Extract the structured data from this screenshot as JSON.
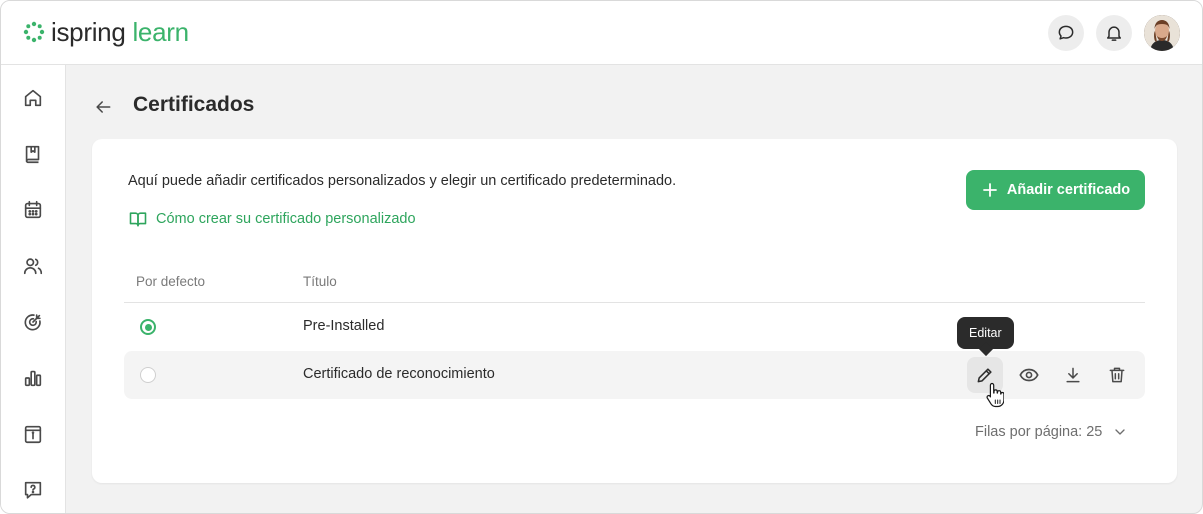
{
  "app": {
    "logo_word1": "ispring",
    "logo_word2": "learn",
    "brand_color": "#3bb36b"
  },
  "header": {
    "icons": [
      "chat-icon",
      "bell-icon",
      "user-avatar"
    ]
  },
  "sidebar": {
    "items": [
      {
        "icon": "home-icon"
      },
      {
        "icon": "book-icon"
      },
      {
        "icon": "calendar-icon"
      },
      {
        "icon": "users-icon"
      },
      {
        "icon": "target-icon"
      },
      {
        "icon": "bar-chart-icon"
      },
      {
        "icon": "archive-info-icon"
      },
      {
        "icon": "help-chat-icon"
      }
    ]
  },
  "page": {
    "title": "Certificados",
    "description": "Aquí puede añadir certificados personalizados y elegir un certificado predeterminado.",
    "help_link": "Cómo crear su certificado personalizado",
    "add_button": "Añadir certificado"
  },
  "table": {
    "columns": [
      "Por defecto",
      "Título"
    ],
    "rows": [
      {
        "title": "Pre-Installed",
        "default": true
      },
      {
        "title": "Certificado de reconocimiento",
        "default": false
      }
    ],
    "row_actions": [
      "edit-icon",
      "eye-icon",
      "download-icon",
      "trash-icon"
    ],
    "tooltip": "Editar"
  },
  "pagination": {
    "label": "Filas por página: 25"
  }
}
